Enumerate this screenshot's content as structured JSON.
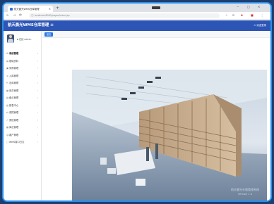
{
  "browser": {
    "tab_title": "航天晨光WMS仓库管理",
    "tab_close": "×",
    "new_tab": "+",
    "url": "localhost:8080/pages/index.jsp",
    "window_controls": [
      "−",
      "□",
      "×"
    ],
    "toolbar_icons": [
      "☆",
      "⟳",
      "✚",
      "■",
      "⋮"
    ]
  },
  "header": {
    "title": "航天晨光WMS仓库管理",
    "collapse_icon": "≡",
    "user_menu": "⊙ 欢迎登录"
  },
  "sidebar": {
    "user_name": "admin",
    "status": "在线",
    "items": [
      {
        "label": "系统管理",
        "active": true
      },
      {
        "label": "基础资料"
      },
      {
        "label": "采购管理"
      },
      {
        "label": "入库管理"
      },
      {
        "label": "出库管理"
      },
      {
        "label": "库存管理"
      },
      {
        "label": "盘点管理"
      },
      {
        "label": "报表中心"
      },
      {
        "label": "调拨管理"
      },
      {
        "label": "质检管理"
      },
      {
        "label": "库位管理"
      },
      {
        "label": "客户管理"
      },
      {
        "label": "WMS接口日志"
      }
    ]
  },
  "content": {
    "home_tab": "首页",
    "watermark_line1": "航天晨光仓储管理系统",
    "watermark_line2": "Version 1.0"
  }
}
